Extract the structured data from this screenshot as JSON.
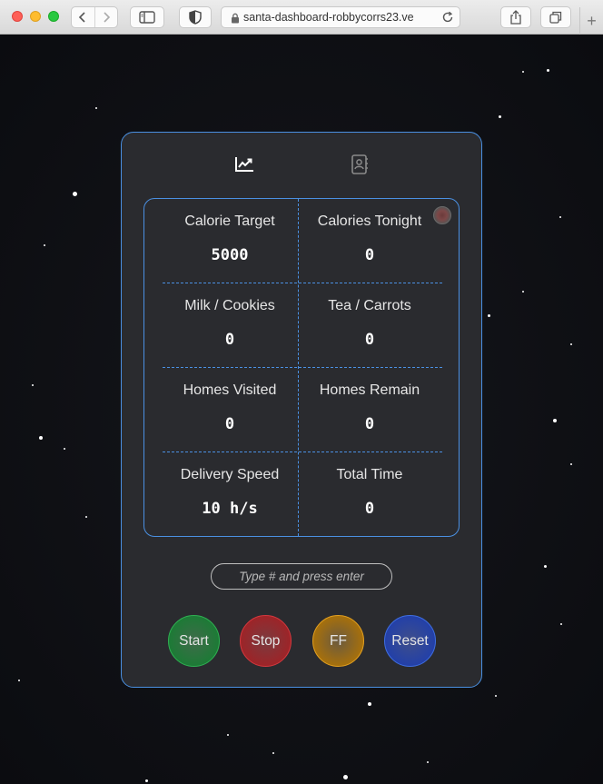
{
  "browser": {
    "url": "santa-dashboard-robbycorrs23.ve",
    "icons": {
      "back": "chevron-left-icon",
      "forward": "chevron-right-icon",
      "sidebar": "sidebar-icon",
      "privacy": "shield-icon",
      "lock": "lock-icon",
      "reload": "reload-icon",
      "share": "share-icon",
      "tabs": "tabs-icon",
      "new_tab": "plus-icon"
    }
  },
  "dashboard": {
    "tabs": [
      {
        "icon": "chart-line-icon"
      },
      {
        "icon": "contacts-book-icon"
      }
    ],
    "stats": [
      {
        "label": "Calorie Target",
        "value": "5000"
      },
      {
        "label": "Calories Tonight",
        "value": "0"
      },
      {
        "label": "Milk / Cookies",
        "value": "0"
      },
      {
        "label": "Tea / Carrots",
        "value": "0"
      },
      {
        "label": "Homes Visited",
        "value": "0"
      },
      {
        "label": "Homes Remain",
        "value": "0"
      },
      {
        "label": "Delivery Speed",
        "value": "10 h/s"
      },
      {
        "label": "Total Time",
        "value": "0"
      }
    ],
    "input": {
      "placeholder": "Type # and press enter",
      "value": ""
    },
    "buttons": {
      "start": "Start",
      "stop": "Stop",
      "ff": "FF",
      "reset": "Reset"
    },
    "colors": {
      "accent": "#4a90e2",
      "start": "#1d7a36",
      "stop": "#9d2428",
      "ff": "#a6700c",
      "reset": "#2340a8"
    }
  }
}
